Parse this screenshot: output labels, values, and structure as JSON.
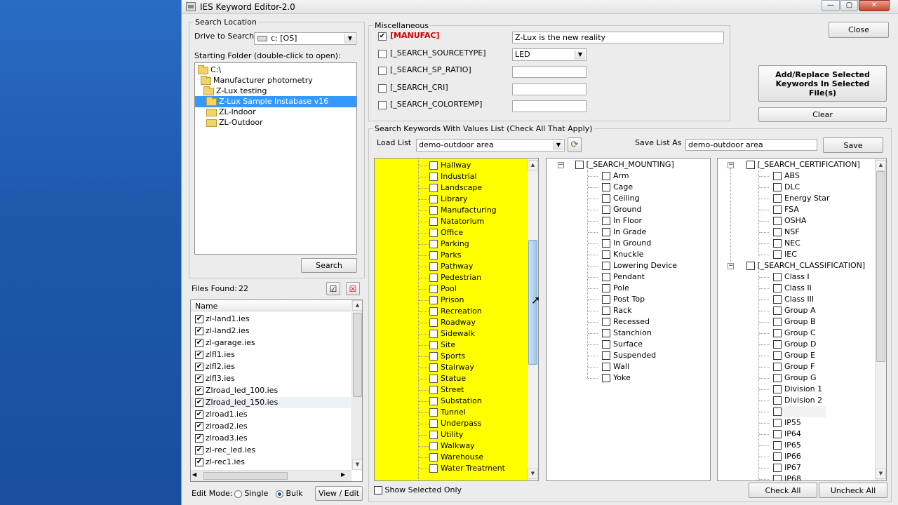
{
  "window": {
    "title": "IES Keyword Editor-2.0",
    "min": "—",
    "max": "▢",
    "close": "✕"
  },
  "search_location": {
    "legend": "Search Location",
    "drive_label": "Drive to Search:",
    "drive_value": "c: [OS]",
    "starting_folder_label": "Starting Folder (double-click to open):",
    "folders": [
      "C:\\",
      "Manufacturer photometry",
      "Z-Lux testing",
      "Z-Lux Sample Instabase v16",
      "ZL-Indoor",
      "ZL-Outdoor"
    ],
    "search_button": "Search"
  },
  "files": {
    "found_label": "Files Found:",
    "found_count": "22",
    "column_name": "Name",
    "items": [
      "zl-land1.ies",
      "zl-land2.ies",
      "zl-garage.ies",
      "zlfl1.ies",
      "zlfl2.ies",
      "zlfl3.ies",
      "Zlroad_led_100.ies",
      "Zlroad_led_150.ies",
      "zlroad1.ies",
      "zlroad2.ies",
      "zlroad3.ies",
      "zl-rec_led.ies",
      "zl-rec1.ies"
    ]
  },
  "edit_mode": {
    "label": "Edit Mode:",
    "single": "Single",
    "bulk": "Bulk",
    "selected": "Bulk",
    "view_edit": "View / Edit"
  },
  "misc": {
    "legend": "Miscellaneous",
    "rows": [
      {
        "keyword": "[MANUFAC]",
        "checked": true,
        "value": "Z-Lux is the new reality",
        "type": "text"
      },
      {
        "keyword": "[_SEARCH_SOURCETYPE]",
        "checked": false,
        "value": "LED",
        "type": "combo"
      },
      {
        "keyword": "[_SEARCH_SP_RATIO]",
        "checked": false,
        "value": "",
        "type": "text"
      },
      {
        "keyword": "[_SEARCH_CRI]",
        "checked": false,
        "value": "",
        "type": "text"
      },
      {
        "keyword": "[_SEARCH_COLORTEMP]",
        "checked": false,
        "value": "",
        "type": "text"
      }
    ],
    "accent_color": "#cc0000"
  },
  "actions": {
    "close": "Close",
    "add_replace": "Add/Replace Selected Keywords In Selected File(s)",
    "clear": "Clear"
  },
  "keywords": {
    "legend": "Search Keywords With Values List (Check All That Apply)",
    "load_list_label": "Load List",
    "load_list_value": "demo-outdoor area",
    "save_list_label": "Save List As",
    "save_list_value": "demo-outdoor area",
    "save_button": "Save",
    "show_selected": "Show Selected Only",
    "check_all": "Check All",
    "uncheck_all": "Uncheck All",
    "highlight_color": "#ffff00",
    "application_items": [
      "Hallway",
      "Industrial",
      "Landscape",
      "Library",
      "Manufacturing",
      "Natatorium",
      "Office",
      "Parking",
      "Parks",
      "Pathway",
      "Pedestrian",
      "Pool",
      "Prison",
      "Recreation",
      "Roadway",
      "Sidewalk",
      "Site",
      "Sports",
      "Stairway",
      "Statue",
      "Street",
      "Substation",
      "Tunnel",
      "Underpass",
      "Utility",
      "Walkway",
      "Warehouse",
      "Water Treatment"
    ],
    "mounting_title": "[_SEARCH_MOUNTING]",
    "mounting_items": [
      "Arm",
      "Cage",
      "Ceiling",
      "Ground",
      "In Floor",
      "In Grade",
      "In Ground",
      "Knuckle",
      "Lowering Device",
      "Pendant",
      "Pole",
      "Post Top",
      "Rack",
      "Recessed",
      "Stanchion",
      "Surface",
      "Suspended",
      "Wall",
      "Yoke"
    ],
    "certification_title": "[_SEARCH_CERTIFICATION]",
    "certification_items": [
      "ABS",
      "DLC",
      "Energy Star",
      "FSA",
      "OSHA",
      "NSF",
      "NEC",
      "IEC"
    ],
    "classification_title": "[_SEARCH_CLASSIFICATION]",
    "classification_items": [
      "Class I",
      "Class II",
      "Class III",
      "Group A",
      "Group B",
      "Group C",
      "Group D",
      "Group E",
      "Group F",
      "Group G",
      "Division 1",
      "Division 2",
      "",
      "IP55",
      "IP64",
      "IP65",
      "IP66",
      "IP67",
      "IP68"
    ]
  }
}
